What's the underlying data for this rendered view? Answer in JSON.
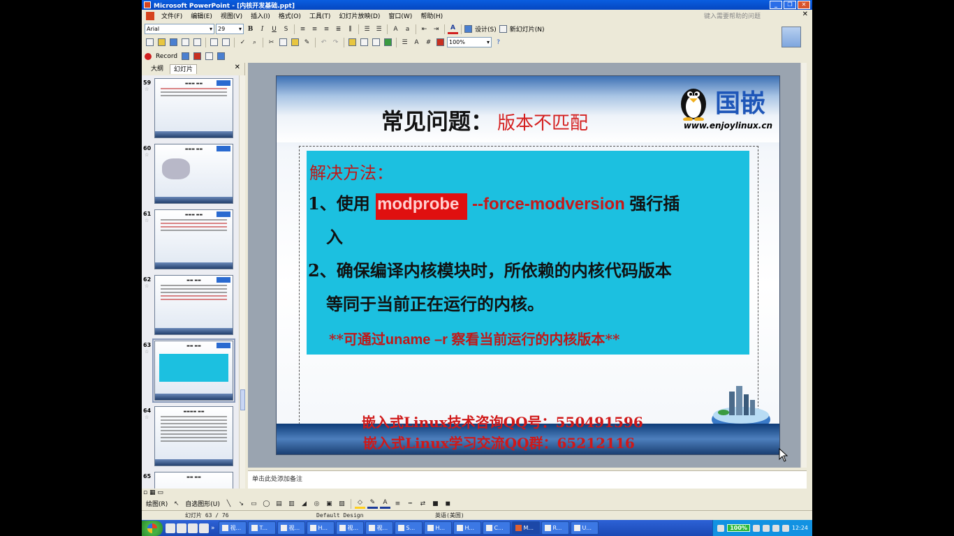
{
  "window": {
    "title": "Microsoft PowerPoint - [内核开发基础.ppt]"
  },
  "menu": [
    "文件(F)",
    "编辑(E)",
    "视图(V)",
    "插入(I)",
    "格式(O)",
    "工具(T)",
    "幻灯片放映(D)",
    "窗口(W)",
    "帮助(H)"
  ],
  "help_placeholder": "键入需要帮助的问题",
  "format_toolbar": {
    "font": "Arial",
    "size": "29",
    "design": "设计(S)",
    "new_slide": "新幻灯片(N)"
  },
  "standard_toolbar": {
    "zoom": "100%"
  },
  "record_toolbar": {
    "record": "Record"
  },
  "pane": {
    "tabs": [
      "大纲",
      "幻灯片"
    ],
    "active_tab": "幻灯片",
    "slides": [
      {
        "num": "59"
      },
      {
        "num": "60"
      },
      {
        "num": "61"
      },
      {
        "num": "62"
      },
      {
        "num": "63"
      },
      {
        "num": "64"
      },
      {
        "num": "65"
      }
    ],
    "selected": "63"
  },
  "slide": {
    "title": "常见问题：",
    "title_red": "版本不匹配",
    "logo_text": "国嵌",
    "logo_url": "www.enjoylinux.cn",
    "solution_head": "解决方法：",
    "line1_prefix": "1、使用 ",
    "line1_cmd": "modprobe ",
    "line1_option": " --force-modversion ",
    "line1_suffix": "强行插",
    "line1_cont": "入",
    "line2": "2、确保编译内核模块时，所依赖的内核代码版本",
    "line2_cont": "等同于当前正在运行的内核。",
    "note_a": "**可通过",
    "note_cmd": "uname –r ",
    "note_b": "察看当前运行的内核版本**",
    "qq1": "嵌入式Linux技术咨询QQ号：550491596",
    "qq2": "嵌入式Linux学习交流QQ群：65212116"
  },
  "notes": {
    "placeholder": "单击此处添加备注"
  },
  "drawing_toolbar": {
    "draw": "绘图(R)",
    "autoshape": "自选图形(U)"
  },
  "status": {
    "slide": "幻灯片 63 / 76",
    "design": "Default Design",
    "lang": "英语(美国)"
  },
  "taskbar": {
    "tasks": [
      "视...",
      "T...",
      "视...",
      "H...",
      "视...",
      "视...",
      "S...",
      "H...",
      "H...",
      "C...",
      "M...",
      "R...",
      "U..."
    ],
    "active": "M...",
    "battery": "100%",
    "clock": "12:24"
  }
}
